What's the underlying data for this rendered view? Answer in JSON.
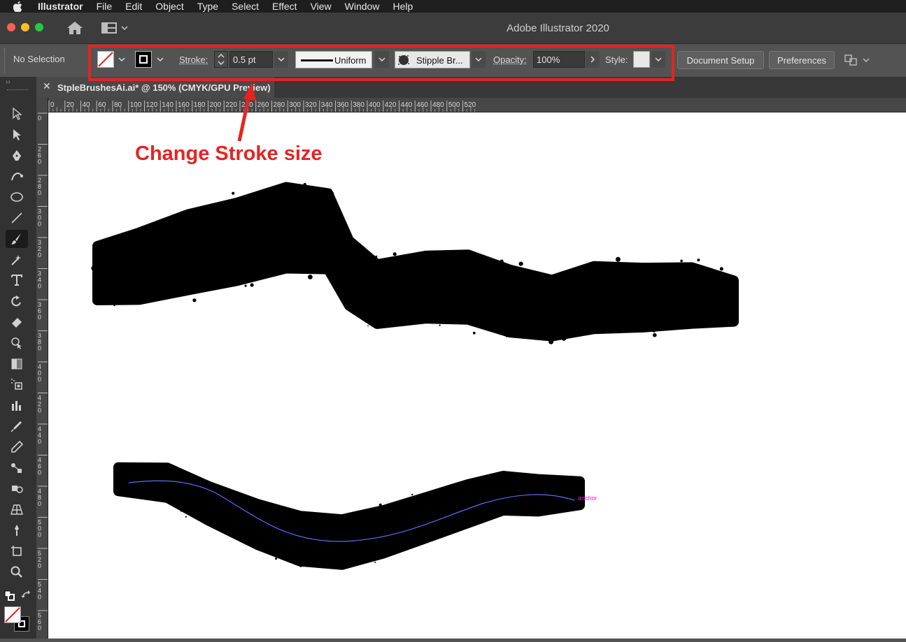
{
  "menubar": {
    "app": "Illustrator",
    "items": [
      "File",
      "Edit",
      "Object",
      "Type",
      "Select",
      "Effect",
      "View",
      "Window",
      "Help"
    ]
  },
  "window": {
    "title": "Adobe Illustrator 2020"
  },
  "control_bar": {
    "selection": "No Selection",
    "stroke_label": "Stroke:",
    "stroke_value": "0.5 pt",
    "profile": "Uniform",
    "brush": "Stipple Br...",
    "opacity_label": "Opacity:",
    "opacity_value": "100%",
    "style_label": "Style:",
    "document_setup": "Document Setup",
    "preferences": "Preferences"
  },
  "document_tab": {
    "title": "StpleBrushesAi.ai* @ 150% (CMYK/GPU Preview)"
  },
  "rulers": {
    "horizontal": [
      "0",
      "20",
      "40",
      "60",
      "80",
      "100",
      "120",
      "140",
      "160",
      "180",
      "200",
      "220",
      "240",
      "260",
      "280",
      "300",
      "320",
      "340",
      "360",
      "380",
      "400",
      "420",
      "440",
      "460",
      "480",
      "500",
      "520"
    ],
    "vertical": [
      "0",
      "260",
      "280",
      "300",
      "320",
      "340",
      "360",
      "380",
      "400",
      "420",
      "440",
      "460",
      "480",
      "500",
      "520",
      "540",
      "560"
    ]
  },
  "canvas": {
    "annotation": "Change Stroke size",
    "anchor_label": "anchor"
  },
  "colors": {
    "annotation_red": "#e52420",
    "path_blue": "#5a6cff",
    "anchor_magenta": "#e020e0"
  },
  "tools": [
    "selection-tool-icon",
    "direct-selection-tool-icon",
    "pen-tool-icon",
    "curvature-tool-icon",
    "ellipse-tool-icon",
    "line-tool-icon",
    "paintbrush-tool-icon",
    "shaper-tool-icon",
    "type-tool-icon",
    "rotate-tool-icon",
    "eraser-tool-icon",
    "shape-builder-tool-icon",
    "gradient-tool-icon",
    "symbol-sprayer-tool-icon",
    "graph-tool-icon",
    "eyedropper-tool-icon",
    "pencil-tool-icon",
    "blend-tool-icon",
    "live-paint-tool-icon",
    "perspective-grid-tool-icon",
    "puppet-warp-tool-icon",
    "artboard-tool-icon",
    "zoom-tool-icon"
  ]
}
